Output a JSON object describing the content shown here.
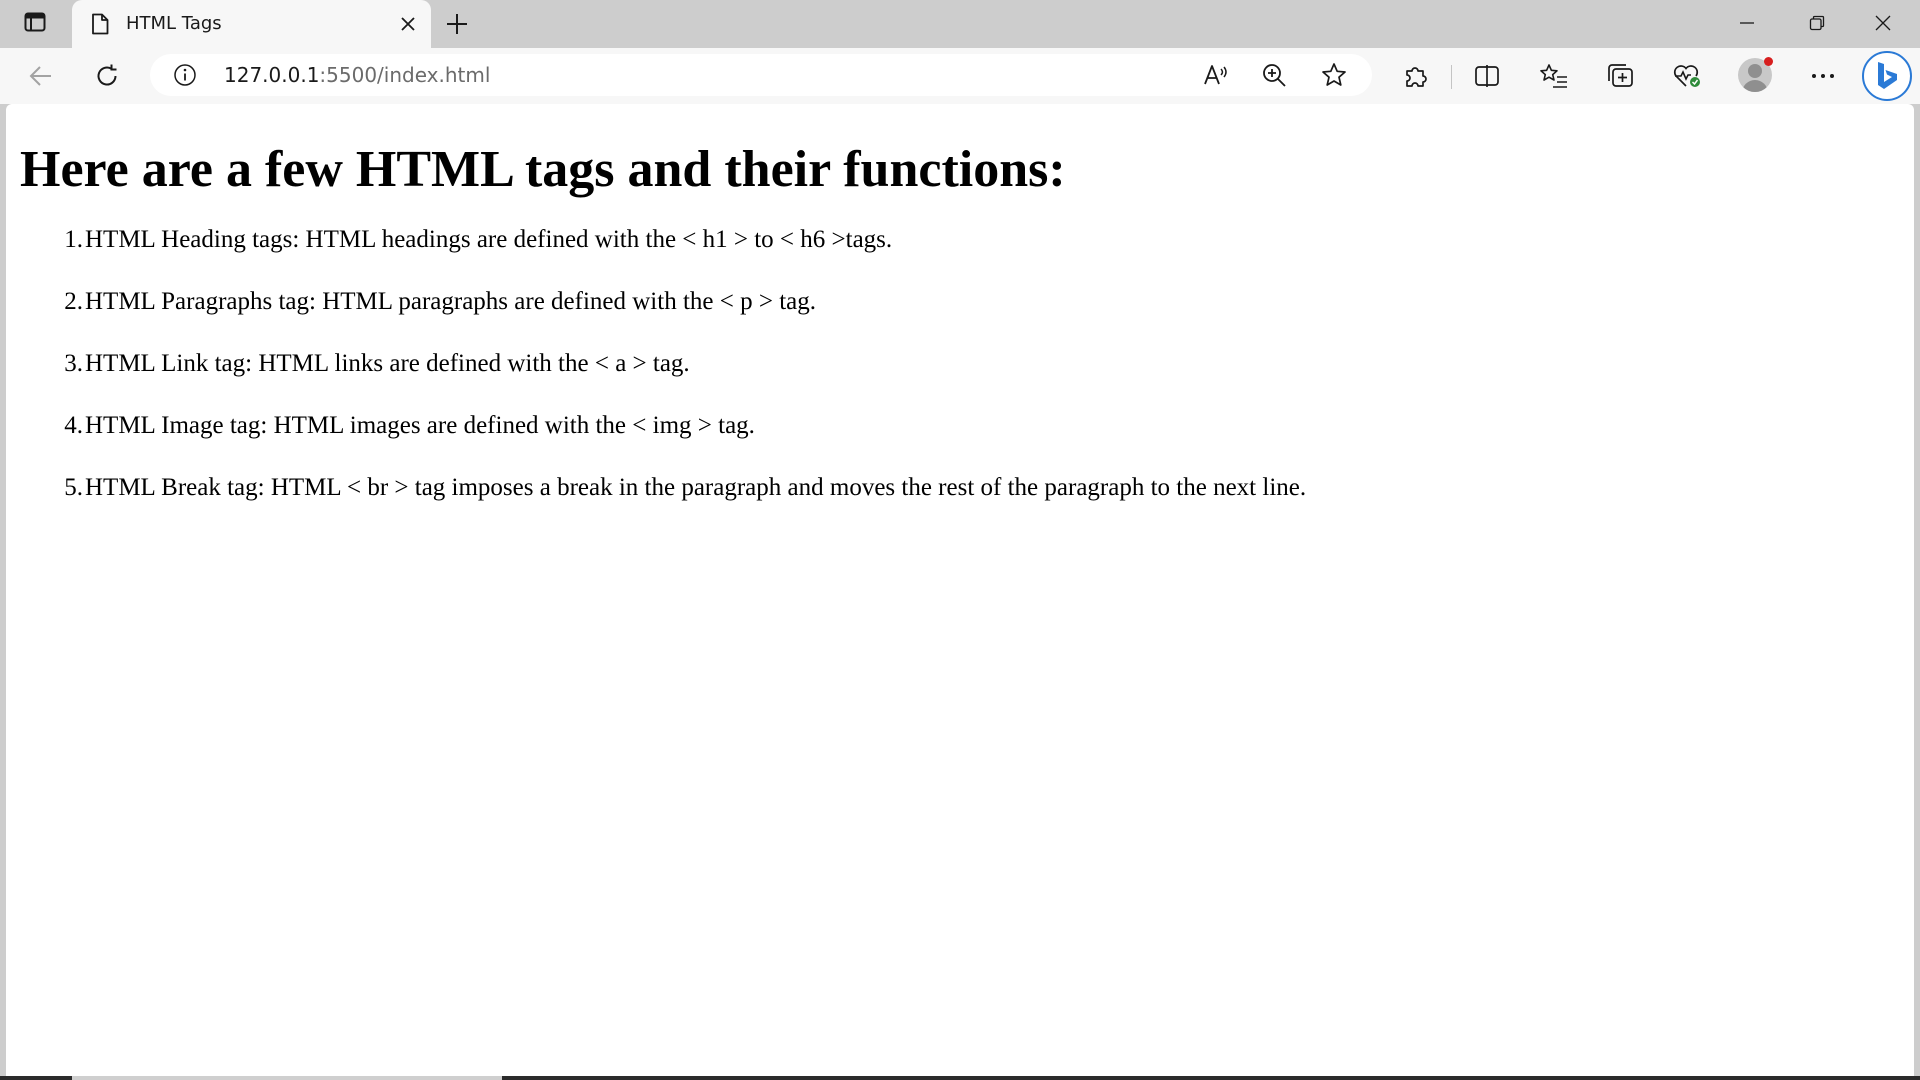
{
  "browser": {
    "tab": {
      "title": "HTML Tags"
    },
    "address_bar": {
      "url_host": "127.0.0.1",
      "url_path": ":5500/index.html"
    },
    "icons": {
      "tab_actions": "tab-actions-icon",
      "favicon": "page-icon",
      "tab_close": "close-icon",
      "new_tab": "plus-icon",
      "minimize": "minimize-icon",
      "maximize": "restore-icon",
      "close_window": "close-icon",
      "back": "back-arrow-icon",
      "refresh": "refresh-icon",
      "site_info": "info-icon",
      "read_aloud": "read-aloud-icon",
      "zoom": "zoom-in-icon",
      "favorite": "star-icon",
      "extensions": "puzzle-icon",
      "split_screen": "split-screen-icon",
      "favorites": "favorites-list-icon",
      "collections": "collections-icon",
      "browser_essentials": "heart-pulse-icon",
      "profile": "avatar-icon",
      "settings_menu": "more-dots-icon",
      "copilot": "bing-icon"
    },
    "colors": {
      "chrome_bg": "#cdcdcd",
      "toolbar_bg": "#f7f7f7",
      "profile_badge": "#d71f1f",
      "bing_accent": "#2b7ad6"
    }
  },
  "page": {
    "heading": "Here are a few HTML tags and their functions:",
    "list": [
      {
        "num": "1.",
        "text": "HTML Heading tags: HTML headings are defined with the < h1 > to < h6 >tags."
      },
      {
        "num": "2.",
        "text": "HTML Paragraphs tag: HTML paragraphs are defined with the < p > tag."
      },
      {
        "num": "3.",
        "text": "HTML Link tag: HTML links are defined with the < a > tag."
      },
      {
        "num": "4.",
        "text": "HTML Image tag: HTML images are defined with the < img > tag."
      },
      {
        "num": "5.",
        "text": "HTML Break tag: HTML < br > tag imposes a break in the paragraph and moves the rest of the paragraph to the next line."
      }
    ]
  }
}
